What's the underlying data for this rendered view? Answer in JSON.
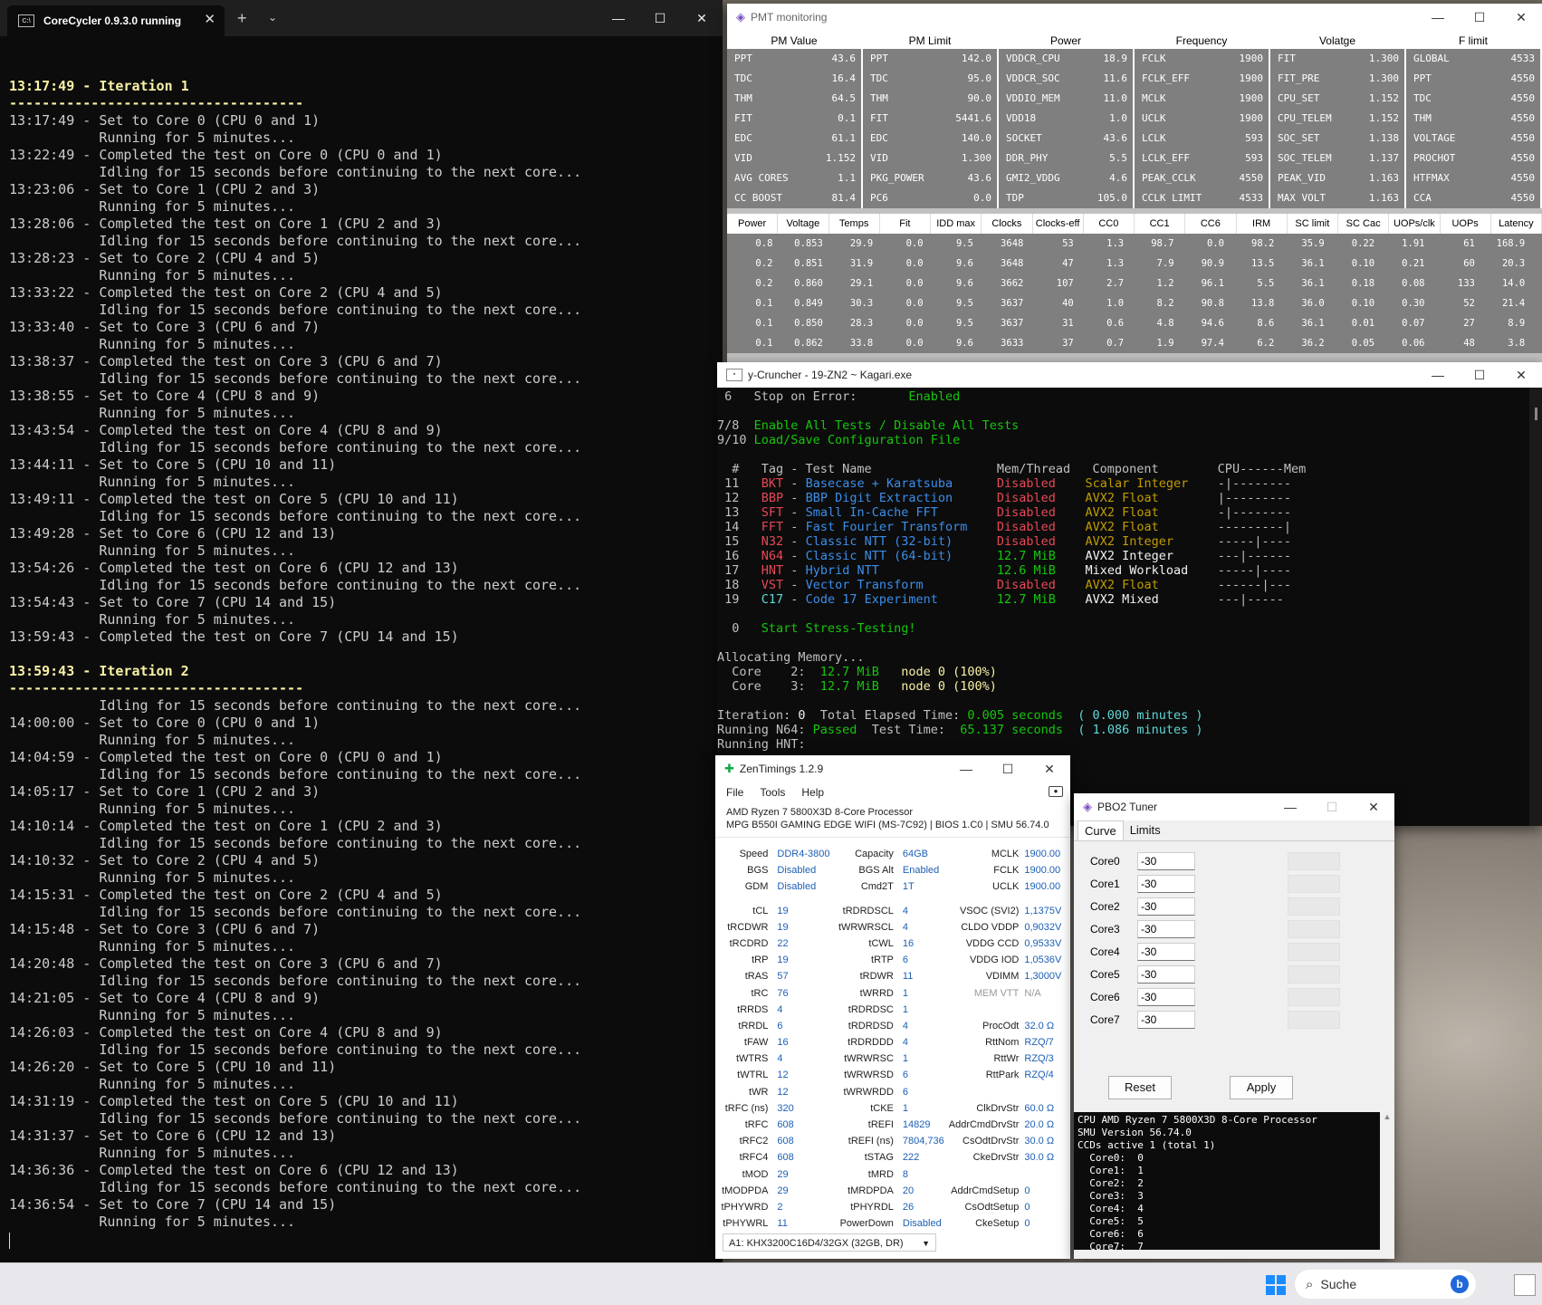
{
  "corecycler": {
    "tab_title": "CoreCycler 0.9.3.0 running",
    "lines": [
      {
        "t": "13:17:49 - Iteration 1",
        "hl": true
      },
      {
        "t": "------------------------------------",
        "hl": true
      },
      {
        "t": "13:17:49 - Set to Core 0 (CPU 0 and 1)"
      },
      {
        "t": "           Running for 5 minutes..."
      },
      {
        "t": "13:22:49 - Completed the test on Core 0 (CPU 0 and 1)"
      },
      {
        "t": "           Idling for 15 seconds before continuing to the next core..."
      },
      {
        "t": "13:23:06 - Set to Core 1 (CPU 2 and 3)"
      },
      {
        "t": "           Running for 5 minutes..."
      },
      {
        "t": "13:28:06 - Completed the test on Core 1 (CPU 2 and 3)"
      },
      {
        "t": "           Idling for 15 seconds before continuing to the next core..."
      },
      {
        "t": "13:28:23 - Set to Core 2 (CPU 4 and 5)"
      },
      {
        "t": "           Running for 5 minutes..."
      },
      {
        "t": "13:33:22 - Completed the test on Core 2 (CPU 4 and 5)"
      },
      {
        "t": "           Idling for 15 seconds before continuing to the next core..."
      },
      {
        "t": "13:33:40 - Set to Core 3 (CPU 6 and 7)"
      },
      {
        "t": "           Running for 5 minutes..."
      },
      {
        "t": "13:38:37 - Completed the test on Core 3 (CPU 6 and 7)"
      },
      {
        "t": "           Idling for 15 seconds before continuing to the next core..."
      },
      {
        "t": "13:38:55 - Set to Core 4 (CPU 8 and 9)"
      },
      {
        "t": "           Running for 5 minutes..."
      },
      {
        "t": "13:43:54 - Completed the test on Core 4 (CPU 8 and 9)"
      },
      {
        "t": "           Idling for 15 seconds before continuing to the next core..."
      },
      {
        "t": "13:44:11 - Set to Core 5 (CPU 10 and 11)"
      },
      {
        "t": "           Running for 5 minutes..."
      },
      {
        "t": "13:49:11 - Completed the test on Core 5 (CPU 10 and 11)"
      },
      {
        "t": "           Idling for 15 seconds before continuing to the next core..."
      },
      {
        "t": "13:49:28 - Set to Core 6 (CPU 12 and 13)"
      },
      {
        "t": "           Running for 5 minutes..."
      },
      {
        "t": "13:54:26 - Completed the test on Core 6 (CPU 12 and 13)"
      },
      {
        "t": "           Idling for 15 seconds before continuing to the next core..."
      },
      {
        "t": "13:54:43 - Set to Core 7 (CPU 14 and 15)"
      },
      {
        "t": "           Running for 5 minutes..."
      },
      {
        "t": "13:59:43 - Completed the test on Core 7 (CPU 14 and 15)"
      },
      {
        "t": ""
      },
      {
        "t": "13:59:43 - Iteration 2",
        "hl": true
      },
      {
        "t": "------------------------------------",
        "hl": true
      },
      {
        "t": "           Idling for 15 seconds before continuing to the next core..."
      },
      {
        "t": "14:00:00 - Set to Core 0 (CPU 0 and 1)"
      },
      {
        "t": "           Running for 5 minutes..."
      },
      {
        "t": "14:04:59 - Completed the test on Core 0 (CPU 0 and 1)"
      },
      {
        "t": "           Idling for 15 seconds before continuing to the next core..."
      },
      {
        "t": "14:05:17 - Set to Core 1 (CPU 2 and 3)"
      },
      {
        "t": "           Running for 5 minutes..."
      },
      {
        "t": "14:10:14 - Completed the test on Core 1 (CPU 2 and 3)"
      },
      {
        "t": "           Idling for 15 seconds before continuing to the next core..."
      },
      {
        "t": "14:10:32 - Set to Core 2 (CPU 4 and 5)"
      },
      {
        "t": "           Running for 5 minutes..."
      },
      {
        "t": "14:15:31 - Completed the test on Core 2 (CPU 4 and 5)"
      },
      {
        "t": "           Idling for 15 seconds before continuing to the next core..."
      },
      {
        "t": "14:15:48 - Set to Core 3 (CPU 6 and 7)"
      },
      {
        "t": "           Running for 5 minutes..."
      },
      {
        "t": "14:20:48 - Completed the test on Core 3 (CPU 6 and 7)"
      },
      {
        "t": "           Idling for 15 seconds before continuing to the next core..."
      },
      {
        "t": "14:21:05 - Set to Core 4 (CPU 8 and 9)"
      },
      {
        "t": "           Running for 5 minutes..."
      },
      {
        "t": "14:26:03 - Completed the test on Core 4 (CPU 8 and 9)"
      },
      {
        "t": "           Idling for 15 seconds before continuing to the next core..."
      },
      {
        "t": "14:26:20 - Set to Core 5 (CPU 10 and 11)"
      },
      {
        "t": "           Running for 5 minutes..."
      },
      {
        "t": "14:31:19 - Completed the test on Core 5 (CPU 10 and 11)"
      },
      {
        "t": "           Idling for 15 seconds before continuing to the next core..."
      },
      {
        "t": "14:31:37 - Set to Core 6 (CPU 12 and 13)"
      },
      {
        "t": "           Running for 5 minutes..."
      },
      {
        "t": "14:36:36 - Completed the test on Core 6 (CPU 12 and 13)"
      },
      {
        "t": "           Idling for 15 seconds before continuing to the next core..."
      },
      {
        "t": "14:36:54 - Set to Core 7 (CPU 14 and 15)"
      },
      {
        "t": "           Running for 5 minutes..."
      }
    ]
  },
  "pmt": {
    "title": "PMT monitoring",
    "groups": [
      {
        "header": "PM Value",
        "rows": [
          [
            "PPT",
            "43.6"
          ],
          [
            "TDC",
            "16.4"
          ],
          [
            "THM",
            "64.5"
          ],
          [
            "FIT",
            "0.1"
          ],
          [
            "EDC",
            "61.1"
          ],
          [
            "VID",
            "1.152"
          ],
          [
            "AVG CORES",
            "1.1"
          ],
          [
            "CC BOOST",
            "81.4"
          ]
        ]
      },
      {
        "header": "PM Limit",
        "rows": [
          [
            "PPT",
            "142.0"
          ],
          [
            "TDC",
            "95.0"
          ],
          [
            "THM",
            "90.0"
          ],
          [
            "FIT",
            "5441.6"
          ],
          [
            "EDC",
            "140.0"
          ],
          [
            "VID",
            "1.300"
          ],
          [
            "PKG_POWER",
            "43.6"
          ],
          [
            "PC6",
            "0.0"
          ]
        ]
      },
      {
        "header": "Power",
        "rows": [
          [
            "VDDCR_CPU",
            "18.9"
          ],
          [
            "VDDCR_SOC",
            "11.6"
          ],
          [
            "VDDIO_MEM",
            "11.0"
          ],
          [
            "VDD18",
            "1.0"
          ],
          [
            "SOCKET",
            "43.6"
          ],
          [
            "DDR_PHY",
            "5.5"
          ],
          [
            "GMI2_VDDG",
            "4.6"
          ],
          [
            "TDP",
            "105.0"
          ]
        ]
      },
      {
        "header": "Frequency",
        "rows": [
          [
            "FCLK",
            "1900"
          ],
          [
            "FCLK_EFF",
            "1900"
          ],
          [
            "MCLK",
            "1900"
          ],
          [
            "UCLK",
            "1900"
          ],
          [
            "LCLK",
            "593"
          ],
          [
            "LCLK_EFF",
            "593"
          ],
          [
            "PEAK_CCLK",
            "4550"
          ],
          [
            "CCLK LIMIT",
            "4533"
          ]
        ]
      },
      {
        "header": "Volatge",
        "rows": [
          [
            "FIT",
            "1.300"
          ],
          [
            "FIT_PRE",
            "1.300"
          ],
          [
            "CPU_SET",
            "1.152"
          ],
          [
            "CPU_TELEM",
            "1.152"
          ],
          [
            "SOC_SET",
            "1.138"
          ],
          [
            "SOC_TELEM",
            "1.137"
          ],
          [
            "PEAK_VID",
            "1.163"
          ],
          [
            "MAX VOLT",
            "1.163"
          ]
        ]
      },
      {
        "header": "F limit",
        "rows": [
          [
            "GLOBAL",
            "4533"
          ],
          [
            "PPT",
            "4550"
          ],
          [
            "TDC",
            "4550"
          ],
          [
            "THM",
            "4550"
          ],
          [
            "VOLTAGE",
            "4550"
          ],
          [
            "PROCHOT",
            "4550"
          ],
          [
            "HTFMAX",
            "4550"
          ],
          [
            "CCA",
            "4550"
          ]
        ]
      }
    ],
    "core_headers": [
      "Power",
      "Voltage",
      "Temps",
      "Fit",
      "IDD max",
      "Clocks",
      "Clocks-eff",
      "CC0",
      "CC1",
      "CC6",
      "IRM",
      "SC limit",
      "SC Cac",
      "UOPs/clk",
      "UOPs",
      "Latency"
    ],
    "core_rows": [
      [
        "0.8",
        "0.853",
        "29.9",
        "0.0",
        "9.5",
        "3648",
        "53",
        "1.3",
        "98.7",
        "0.0",
        "98.2",
        "35.9",
        "0.22",
        "1.91",
        "61",
        "168.9"
      ],
      [
        "0.2",
        "0.851",
        "31.9",
        "0.0",
        "9.6",
        "3648",
        "47",
        "1.3",
        "7.9",
        "90.9",
        "13.5",
        "36.1",
        "0.10",
        "0.21",
        "60",
        "20.3"
      ],
      [
        "0.2",
        "0.860",
        "29.1",
        "0.0",
        "9.6",
        "3662",
        "107",
        "2.7",
        "1.2",
        "96.1",
        "5.5",
        "36.1",
        "0.18",
        "0.08",
        "133",
        "14.0"
      ],
      [
        "0.1",
        "0.849",
        "30.3",
        "0.0",
        "9.5",
        "3637",
        "40",
        "1.0",
        "8.2",
        "90.8",
        "13.8",
        "36.0",
        "0.10",
        "0.30",
        "52",
        "21.4"
      ],
      [
        "0.1",
        "0.850",
        "28.3",
        "0.0",
        "9.5",
        "3637",
        "31",
        "0.6",
        "4.8",
        "94.6",
        "8.6",
        "36.1",
        "0.01",
        "0.07",
        "27",
        "8.9"
      ],
      [
        "0.1",
        "0.862",
        "33.8",
        "0.0",
        "9.6",
        "3633",
        "37",
        "0.7",
        "1.9",
        "97.4",
        "6.2",
        "36.2",
        "0.05",
        "0.06",
        "48",
        "3.8"
      ]
    ]
  },
  "ycruncher": {
    "title": "y-Cruncher - 19-ZN2 ~ Kagari.exe"
  },
  "zentimings": {
    "title": "ZenTimings 1.2.9",
    "menu": [
      "File",
      "Tools",
      "Help"
    ],
    "cpu": "AMD Ryzen 7 5800X3D 8-Core Processor",
    "board": "MPG B550I GAMING EDGE WIFI (MS-7C92) | BIOS 1.C0 | SMU 56.74.0",
    "rows": [
      [
        "Speed",
        "DDR4-3800",
        "Capacity",
        "64GB",
        "MCLK",
        "1900.00"
      ],
      [
        "BGS",
        "Disabled",
        "BGS Alt",
        "Enabled",
        "FCLK",
        "1900.00"
      ],
      [
        "GDM",
        "Disabled",
        "Cmd2T",
        "1T",
        "UCLK",
        "1900.00"
      ],
      [
        "gap"
      ],
      [
        "tCL",
        "19",
        "tRDRDSCL",
        "4",
        "VSOC (SVI2)",
        "1,1375V"
      ],
      [
        "tRCDWR",
        "19",
        "tWRWRSCL",
        "4",
        "CLDO VDDP",
        "0,9032V"
      ],
      [
        "tRCDRD",
        "22",
        "tCWL",
        "16",
        "VDDG CCD",
        "0,9533V"
      ],
      [
        "tRP",
        "19",
        "tRTP",
        "6",
        "VDDG IOD",
        "1,0536V"
      ],
      [
        "tRAS",
        "57",
        "tRDWR",
        "11",
        "VDIMM",
        "1,3000V"
      ],
      [
        "tRC",
        "76",
        "tWRRD",
        "1",
        "MEM VTT",
        "N/A"
      ],
      [
        "tRRDS",
        "4",
        "tRDRDSC",
        "1",
        "",
        ""
      ],
      [
        "tRRDL",
        "6",
        "tRDRDSD",
        "4",
        "ProcOdt",
        "32.0 Ω"
      ],
      [
        "tFAW",
        "16",
        "tRDRDDD",
        "4",
        "RttNom",
        "RZQ/7"
      ],
      [
        "tWTRS",
        "4",
        "tWRWRSC",
        "1",
        "RttWr",
        "RZQ/3"
      ],
      [
        "tWTRL",
        "12",
        "tWRWRSD",
        "6",
        "RttPark",
        "RZQ/4"
      ],
      [
        "tWR",
        "12",
        "tWRWRDD",
        "6",
        "",
        ""
      ],
      [
        "tRFC (ns)",
        "320",
        "tCKE",
        "1",
        "ClkDrvStr",
        "60.0 Ω"
      ],
      [
        "tRFC",
        "608",
        "tREFI",
        "14829",
        "AddrCmdDrvStr",
        "20.0 Ω"
      ],
      [
        "tRFC2",
        "608",
        "tREFI (ns)",
        "7804,736",
        "CsOdtDrvStr",
        "30.0 Ω"
      ],
      [
        "tRFC4",
        "608",
        "tSTAG",
        "222",
        "CkeDrvStr",
        "30.0 Ω"
      ],
      [
        "tMOD",
        "29",
        "tMRD",
        "8",
        "",
        ""
      ],
      [
        "tMODPDA",
        "29",
        "tMRDPDA",
        "20",
        "AddrCmdSetup",
        "0"
      ],
      [
        "tPHYWRD",
        "2",
        "tPHYRDL",
        "26",
        "CsOdtSetup",
        "0"
      ],
      [
        "tPHYWRL",
        "11",
        "PowerDown",
        "Disabled",
        "CkeSetup",
        "0"
      ]
    ],
    "dimm": "A1: KHX3200C16D4/32GX (32GB, DR)"
  },
  "pbo2": {
    "title": "PBO2 Tuner",
    "tabs": [
      "Curve",
      "Limits"
    ],
    "cores": [
      {
        "label": "Core0",
        "value": "-30"
      },
      {
        "label": "Core1",
        "value": "-30"
      },
      {
        "label": "Core2",
        "value": "-30"
      },
      {
        "label": "Core3",
        "value": "-30"
      },
      {
        "label": "Core4",
        "value": "-30"
      },
      {
        "label": "Core5",
        "value": "-30"
      },
      {
        "label": "Core6",
        "value": "-30"
      },
      {
        "label": "Core7",
        "value": "-30"
      }
    ],
    "reset_label": "Reset",
    "apply_label": "Apply",
    "log": "CPU AMD Ryzen 7 5800X3D 8-Core Processor\nSMU Version 56.74.0\nCCDs active 1 (total 1)\n  Core0:  0\n  Core1:  1\n  Core2:  2\n  Core3:  3\n  Core4:  4\n  Core5:  5\n  Core6:  6\n  Core7:  7"
  },
  "taskbar": {
    "search_label": "Suche"
  }
}
